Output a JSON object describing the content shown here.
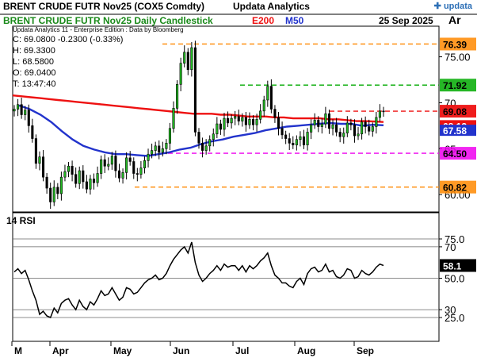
{
  "header": {
    "line1_left": "BRENT CRUDE FUTR  Nov25 (COX5 Comdty)",
    "line1_right": "Updata Analytics",
    "line2_left": "BRENT CRUDE FUTR  Nov25 Daily Candlestick",
    "e200_label": "E200",
    "m50_label": "M50",
    "date": "25 Sep 2025",
    "ar": "Ar",
    "logo": "updata"
  },
  "info": {
    "source": "Updata Analytics 11 - Enterprise Edition : Data by Bloomberg",
    "close": "C: 69.0800  -0.2300 (-0.33%)",
    "high": "H: 69.3300",
    "low": "L: 68.5800",
    "open": "O: 69.0400",
    "tick": "T: 13:47:40"
  },
  "rsi_label": "14 RSI",
  "colors": {
    "e200": "#ee1111",
    "m50": "#2233cc",
    "orange": "#ff8800",
    "green": "#00aa00",
    "magenta": "#ee00ee",
    "red_dash": "#ee1111"
  },
  "chart_data": [
    {
      "type": "candlestick",
      "title": "BRENT CRUDE FUTR  Nov25 Daily Candlestick",
      "x_tick_labels": [
        "M",
        "Apr",
        "May",
        "Jun",
        "Jul",
        "Aug",
        "Sep"
      ],
      "y_tick_labels": [
        "75.00",
        "70",
        "65",
        "60.00"
      ],
      "ylim": [
        57.5,
        78.0
      ],
      "grid": false,
      "horizontal_levels": [
        {
          "value": 76.39,
          "label": "76.39",
          "color": "#ff8800",
          "style": "dashed"
        },
        {
          "value": 71.92,
          "label": "71.92",
          "color": "#00aa00",
          "style": "dashed"
        },
        {
          "value": 69.08,
          "label": "69.08",
          "color": "#ee1111",
          "style": "dashed"
        },
        {
          "value": 64.5,
          "label": "64.50",
          "color": "#ee00ee",
          "style": "dashed"
        },
        {
          "value": 60.82,
          "label": "60.82",
          "color": "#ff8800",
          "style": "dashed"
        }
      ],
      "current_value_badges": [
        {
          "value": 67.5,
          "label": "68.12",
          "color": "#ee1111"
        },
        {
          "value": 67.0,
          "label": "67.58",
          "color": "#2233cc"
        }
      ],
      "series": [
        {
          "name": "Price",
          "type": "close",
          "values": [
            69.3,
            69.8,
            68.7,
            69.2,
            67.5,
            66.1,
            63.4,
            64.1,
            61.9,
            60.7,
            59.2,
            60.8,
            60.1,
            61.9,
            62.5,
            63.1,
            62.2,
            61.2,
            62.6,
            61.4,
            60.6,
            61.7,
            61.3,
            62.3,
            63.8,
            63.1,
            63.3,
            64.2,
            62.6,
            61.8,
            62.4,
            64.0,
            63.6,
            62.3,
            62.2,
            62.9,
            63.7,
            64.4,
            64.8,
            65.3,
            64.6,
            65.0,
            65.6,
            67.2,
            69.4,
            72.0,
            74.3,
            75.5,
            73.6,
            76.0,
            66.8,
            65.6,
            64.8,
            65.3,
            66.0,
            66.6,
            67.7,
            67.1,
            68.3,
            67.8,
            68.3,
            68.5,
            68.0,
            68.4,
            67.6,
            68.2,
            67.6,
            68.2,
            69.1,
            70.3,
            71.8,
            69.3,
            68.4,
            67.2,
            66.5,
            66.1,
            65.6,
            65.4,
            66.0,
            66.3,
            65.4,
            66.8,
            67.6,
            68.1,
            67.4,
            67.7,
            68.8,
            67.2,
            67.6,
            66.8,
            66.3,
            66.7,
            67.8,
            67.6,
            66.4,
            66.6,
            67.9,
            67.4,
            66.9,
            67.4,
            68.4,
            69.1,
            69.08
          ]
        },
        {
          "name": "E200",
          "type": "line",
          "values": [
            70.8,
            70.7,
            70.6,
            70.5,
            70.4,
            70.3,
            70.2,
            70.1,
            70.0,
            69.9,
            69.8,
            69.7,
            69.6,
            69.5,
            69.4,
            69.3,
            69.2,
            69.1,
            69.0,
            68.9,
            68.8,
            68.8,
            68.8,
            68.7,
            68.7,
            68.6,
            68.5,
            68.5,
            68.5,
            68.4,
            68.4,
            68.3,
            68.3,
            68.3,
            68.3,
            68.2,
            68.2,
            68.1,
            68.0,
            68.0,
            67.95,
            67.9
          ]
        },
        {
          "name": "M50",
          "type": "line",
          "values": [
            69.7,
            69.3,
            68.7,
            67.9,
            66.9,
            66.0,
            65.3,
            64.9,
            64.6,
            64.4,
            64.4,
            64.3,
            64.2,
            64.4,
            64.6,
            64.9,
            65.1,
            65.5,
            65.8,
            66.0,
            66.3,
            66.5,
            66.7,
            67.0,
            67.2,
            67.4,
            67.5,
            67.6,
            67.7,
            67.8,
            67.7,
            67.7,
            67.5,
            67.6,
            67.55
          ]
        }
      ]
    },
    {
      "type": "line",
      "title": "14 RSI",
      "x_tick_labels": [
        "M",
        "Apr",
        "May",
        "Jun",
        "Jul",
        "Aug",
        "Sep"
      ],
      "y_tick_labels": [
        "75.0",
        "70",
        "50.0",
        "30",
        "25.0"
      ],
      "reference_lines": [
        75,
        70,
        50,
        30,
        25
      ],
      "ylim": [
        18,
        85
      ],
      "current_value_label": "58.1",
      "series": [
        {
          "name": "RSI",
          "values": [
            54,
            56,
            53,
            55,
            49,
            42,
            36,
            27,
            29,
            26,
            25,
            31,
            28,
            34,
            36,
            37,
            33,
            30,
            36,
            32,
            30,
            35,
            33,
            37,
            42,
            39,
            40,
            44,
            40,
            36,
            38,
            44,
            43,
            40,
            41,
            44,
            47,
            49,
            50,
            52,
            49,
            50,
            53,
            58,
            62,
            65,
            68,
            70,
            66,
            73,
            60,
            52,
            48,
            50,
            53,
            55,
            58,
            55,
            59,
            57,
            58,
            58,
            55,
            58,
            54,
            58,
            56,
            58,
            61,
            63,
            66,
            58,
            52,
            50,
            47,
            47,
            45,
            44,
            48,
            50,
            46,
            53,
            56,
            57,
            54,
            55,
            59,
            54,
            55,
            51,
            50,
            52,
            56,
            55,
            50,
            51,
            55,
            53,
            52,
            54,
            57,
            59,
            58.1
          ]
        }
      ]
    }
  ]
}
